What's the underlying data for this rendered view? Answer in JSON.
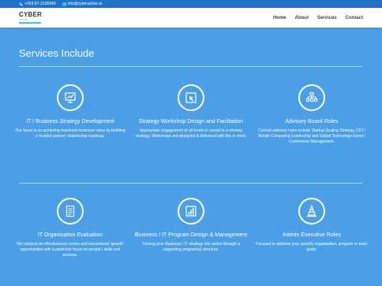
{
  "topbar": {
    "phone": "+353-87-2236949",
    "email": "info@cyberactive.ie"
  },
  "logo": {
    "name": "CYBER",
    "tagline": "ACTIVE"
  },
  "nav": [
    "Home",
    "About",
    "Services",
    "Contact"
  ],
  "section": {
    "title": "Services Include"
  },
  "services": [
    {
      "icon": "presentation-chart-icon",
      "title": "IT / Business Strategy Development",
      "description": "Our focus is on achieving maximum business value by building a 'trusted partner' relationship roadmap."
    },
    {
      "icon": "pointer-cursor-icon",
      "title": "Strategy Workshop Design and Facilitation",
      "description": "Appropriate engagement at all levels is crucial to a winning strategy. Workshops are designed & delivered with this in mind."
    },
    {
      "icon": "org-chart-icon",
      "title": "Advisory Board Roles",
      "description": "Current advisory roles include Startup-Scaling Strategy, CIO / Mobile Computing Leadership and Global Technology Event / Conference Management."
    },
    {
      "icon": "document-icon",
      "title": "IT Organisation Evaluation",
      "description": "We conduct an effectiveness review and recommend 'growth' opportunities with a particular focus on people / skills and process."
    },
    {
      "icon": "bar-chart-icon",
      "title": "Business / IT Program Design & Management",
      "description": "Turning your Business / IT strategy into action through a supporting program(s) structure."
    },
    {
      "icon": "traffic-cone-icon",
      "title": "Interim Executive Roles",
      "description": "Focused to address your specific organisation, program or team goals."
    }
  ]
}
